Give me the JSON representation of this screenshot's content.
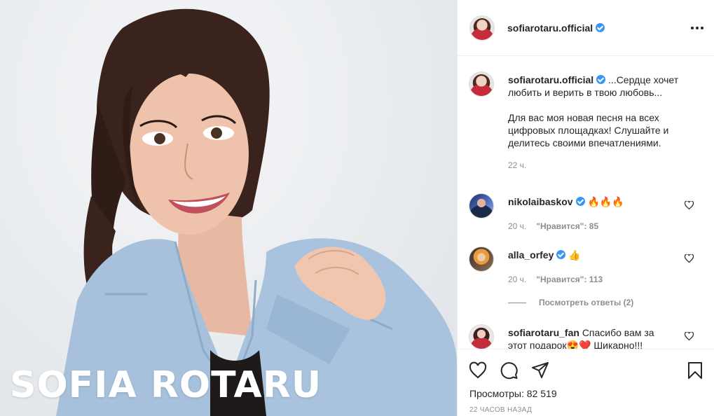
{
  "post": {
    "author": "sofiarotaru.official",
    "verified": true,
    "image_overlay_text": "SOFIA ROTARU"
  },
  "header": {
    "username": "sofiarotaru.official",
    "more_icon": "more-horizontal-icon"
  },
  "caption": {
    "username": "sofiarotaru.official",
    "text_line1": "...Сердце хочет",
    "text_line2": "любить и верить в твою любовь...",
    "text_line3": "Для вас моя новая песня на всех",
    "text_line4": "цифровых площадках! Слушайте и",
    "text_line5": "делитесь своими впечатлениями.",
    "time": "22 ч."
  },
  "comments": [
    {
      "username": "nikolaibaskov",
      "verified": true,
      "text": "🔥🔥🔥",
      "time": "20 ч.",
      "likes": "\"Нравится\": 85"
    },
    {
      "username": "alla_orfey",
      "verified": true,
      "text": "👍",
      "time": "20 ч.",
      "likes": "\"Нравится\": 113",
      "replies": "Посмотреть ответы (2)"
    },
    {
      "username": "sofiarotaru_fan",
      "verified": false,
      "text_line1": "Спасибо вам за",
      "text_line2": "этот подарок😍❤️ Шикарно!!!"
    }
  ],
  "actions": {
    "like_icon": "heart-icon",
    "comment_icon": "comment-icon",
    "share_icon": "paper-plane-icon",
    "save_icon": "bookmark-icon"
  },
  "stats": {
    "views_label": "Просмотры:",
    "views_count": "82 519",
    "posted": "22 часов назад"
  },
  "colors": {
    "verified": "#3897f0",
    "text": "#262626",
    "muted": "#8e8e8e",
    "border": "#efefef",
    "denim": "#a9c3de"
  }
}
